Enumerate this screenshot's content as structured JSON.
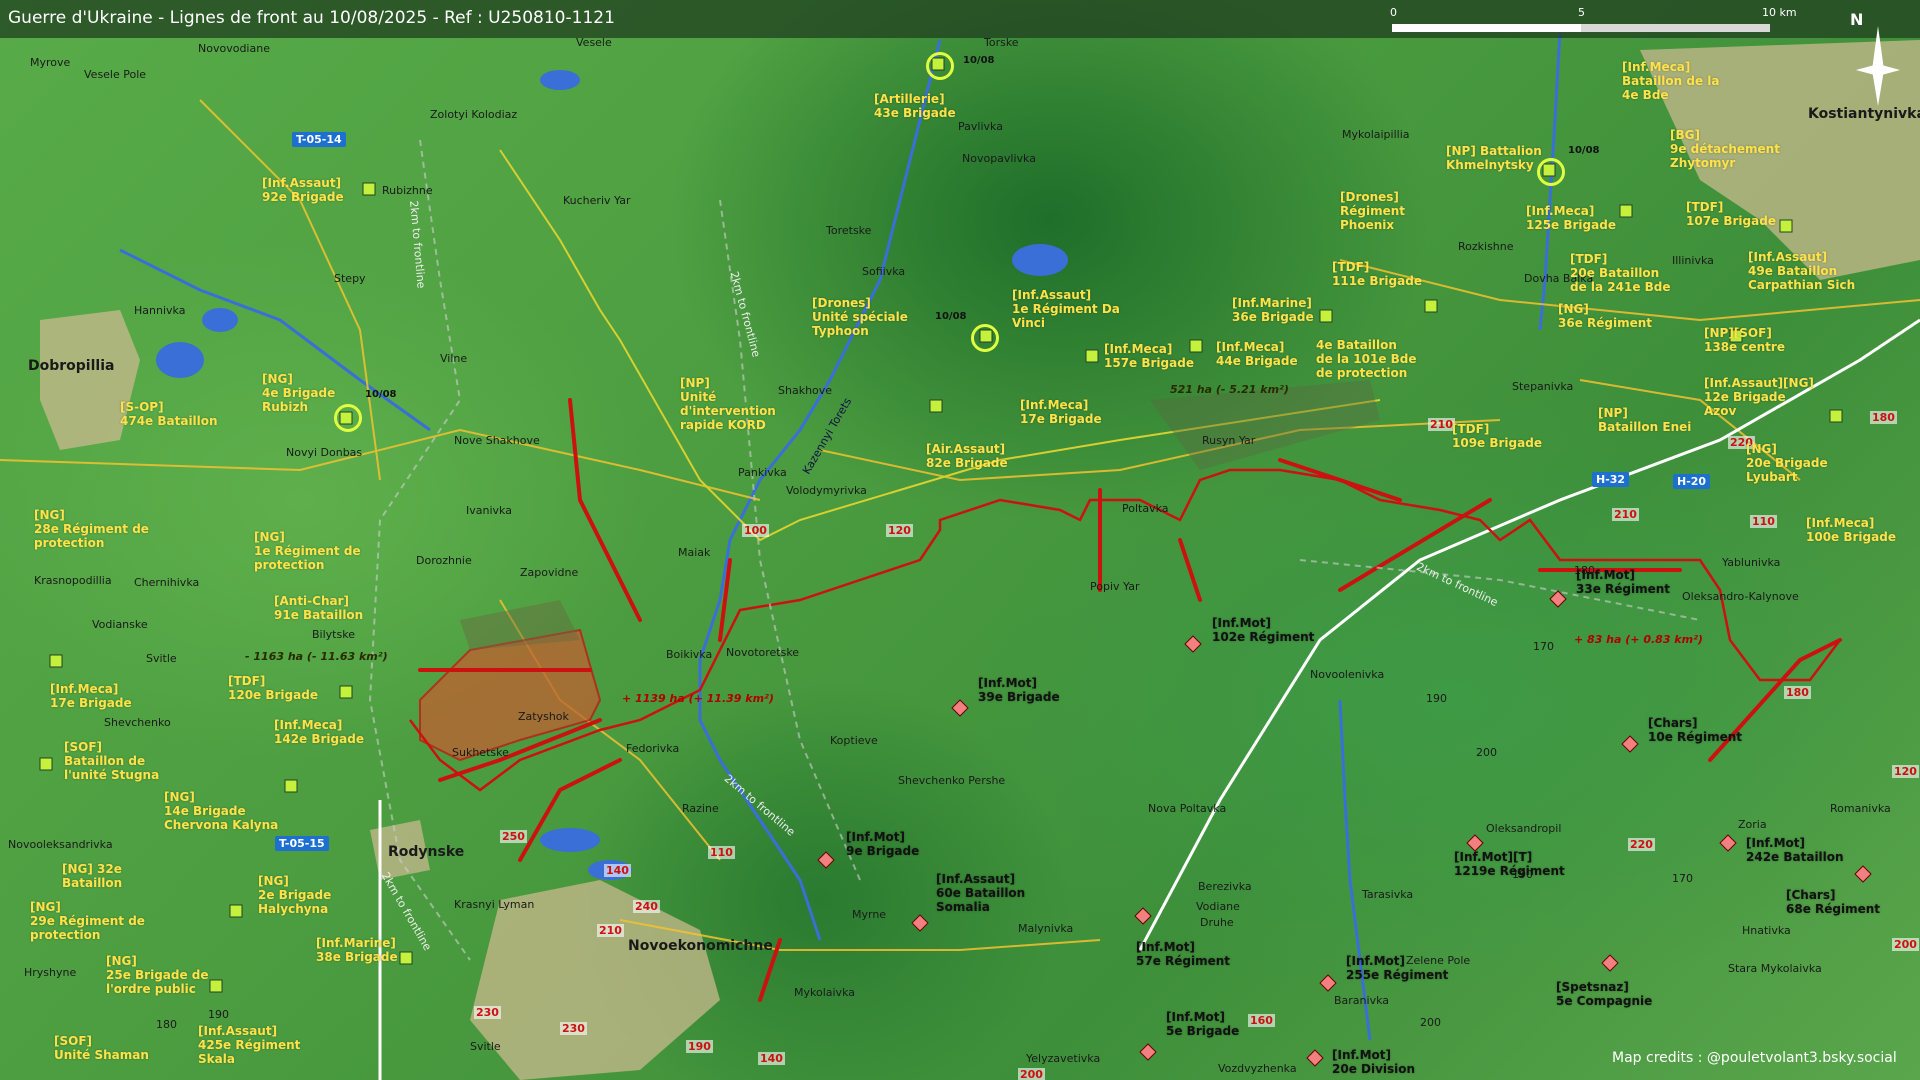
{
  "header": {
    "title": "Guerre d'Ukraine - Lignes de front au 10/08/2025 - Ref : U250810-1121"
  },
  "scale": {
    "labels": [
      "0",
      "5",
      "10 km"
    ]
  },
  "north": "N",
  "credits": "Map credits : @pouletvolant3.bsky.social",
  "dates": [
    "10/08",
    "10/08",
    "10/08",
    "10/08"
  ],
  "areas": {
    "loss1": "- 1163 ha (- 11.63 km²)",
    "gain1": "+ 1139 ha (+ 11.39 km²)",
    "loss2": "521 ha (- 5.21 km²)",
    "gain2": "+ 83 ha (+ 0.83 km²)"
  },
  "roads": [
    "T-05-14",
    "T-05-15",
    "H-32",
    "H-20"
  ],
  "routes": [
    "100",
    "120",
    "210",
    "220",
    "210",
    "110",
    "180",
    "250",
    "110",
    "140",
    "240",
    "210",
    "230",
    "230",
    "190",
    "140",
    "200",
    "160",
    "220",
    "120",
    "200",
    "180"
  ],
  "labels": {
    "frontline": [
      "2km to frontline",
      "2km to frontline",
      "2km to frontline",
      "2km to frontline",
      "2km to frontline"
    ],
    "canal": "Kazennyi Torets"
  },
  "towns": [
    "Vesele",
    "Torske",
    "Myrove",
    "Vesele Pole",
    "Novovodiane",
    "Zolotyi Kolodiaz",
    "Pavlivka",
    "Novopavlivka",
    "Rubizhne",
    "Kucheriv Yar",
    "Toretske",
    "Mykolaipillia",
    "Kostiantynivka",
    "Stepy",
    "Sofiivka",
    "Rozkishne",
    "Illinivka",
    "Dovha Balka",
    "Hannivka",
    "Dobropillia",
    "Vilne",
    "Shakhove",
    "Stepanivka",
    "Novyi Donbas",
    "Nove Shakhove",
    "Rusyn Yar",
    "Pankivka",
    "Ivanivka",
    "Volodymyrivka",
    "Poltavka",
    "Dorozhnie",
    "Maiak",
    "Krasnopodillia",
    "Chernihivka",
    "Zapovidne",
    "Yablunivka",
    "Popiv Yar",
    "Oleksandro-Kalynove",
    "Bilytske",
    "Vodianske",
    "Svitle",
    "Boikivka",
    "Novotoretske",
    "Novoolenivka",
    "Shevchenko",
    "Zatyshok",
    "Koptieve",
    "Sukhetske",
    "Fedorivka",
    "Shevchenko Pershe",
    "Nova Poltavka",
    "Oleksandropil",
    "Romanivka",
    "Novooleksandrivka",
    "Razine",
    "Zoria",
    "Rodynske",
    "Berezivka",
    "Tarasivka",
    "Vodiane",
    "Druhe",
    "Krasnyi Lyman",
    "Myrne",
    "Malynivka",
    "Hnativka",
    "Novoekonomichne",
    "Zelene Pole",
    "Stara Mykolaivka",
    "Hryshyne",
    "Mykolaivka",
    "Baranivka",
    "Svitle",
    "Yelyzavetivka",
    "Vozdvyzhenka"
  ],
  "spot_heights": [
    "170",
    "190",
    "200",
    "180",
    "190",
    "180",
    "170",
    "190",
    "200"
  ],
  "units_ua": [
    "[Artillerie]\n43e Brigade",
    "[Inf.Assaut]\n92e Brigade",
    "[NG]\n4e Brigade\nRubizh",
    "[S-OP]\n474e Bataillon",
    "[Drones]\nUnité spéciale\nTyphoon",
    "[Inf.Assaut]\n1e Régiment Da\nVinci",
    "[NP]\nUnité\nd'intervention\nrapide KORD",
    "[Inf.Meca]\n157e Brigade",
    "[Inf.Meca]\n44e Brigade",
    "[Inf.Marine]\n36e Brigade",
    "[Inf.Meca]\n17e Brigade",
    "[Air.Assaut]\n82e Brigade",
    "[Drones]\nRégiment\nPhoenix",
    "[TDF]\n111e Brigade",
    "4e Bataillon\nde la 101e Bde\nde protection",
    "[NP] Battalion\nKhmelnytsky",
    "[Inf.Meca]\n125e Brigade",
    "[Inf.Meca]\nBataillon de la\n4e Bde",
    "[BG]\n9e détachement\nZhytomyr",
    "[TDF]\n107e Brigade",
    "[TDF]\n20e Bataillon\nde la 241e Bde",
    "[Inf.Assaut]\n49e Bataillon\nCarpathian Sich",
    "[NG]\n36e Régiment",
    "[NP][SOF]\n138e centre",
    "[Inf.Assaut][NG]\n12e Brigade\nAzov",
    "[NP]\nBataillon Enei",
    "[TDF]\n109e Brigade",
    "[NG]\n20e Brigade\nLyubart",
    "[Inf.Meca]\n100e Brigade",
    "[NG]\n28e Régiment de\nprotection",
    "[NG]\n1e Régiment de\nprotection",
    "[Anti-Char]\n91e Bataillon",
    "[Inf.Meca]\n17e Brigade",
    "[TDF]\n120e Brigade",
    "[Inf.Meca]\n142e Brigade",
    "[SOF]\nBataillon de\nl'unité Stugna",
    "[NG]\n14e Brigade\nChervona Kalyna",
    "[NG] 32e\nBataillon",
    "[NG]\n2e Brigade\nHalychyna",
    "[NG]\n29e Régiment de\nprotection",
    "[Inf.Marine]\n38e Brigade",
    "[NG]\n25e Brigade de\nl'ordre public",
    "[SOF]\nUnité Shaman",
    "[Inf.Assaut]\n425e Régiment\nSkala"
  ],
  "units_ru": [
    "[Inf.Mot]\n102e Régiment",
    "[Inf.Mot]\n33e Régiment",
    "[Inf.Mot]\n39e Brigade",
    "[Chars]\n10e Régiment",
    "[Inf.Mot]\n9e Brigade",
    "[Inf.Assaut]\n60e Bataillon\nSomalia",
    "[Inf.Mot][T]\n1219e Régiment",
    "[Inf.Mot]\n242e Bataillon",
    "[Chars]\n68e Régiment",
    "[Inf.Mot]\n57e Régiment",
    "[Inf.Mot]\n255e Régiment",
    "[Spetsnaz]\n5e Compagnie",
    "[Inf.Mot]\n5e Brigade",
    "[Inf.Mot]\n20e Division"
  ],
  "colors": {
    "ua_unit": "#ffe24a",
    "ru_front": "#cc1111",
    "ru_gain_fill": "#c06030",
    "water": "#3a6fd8",
    "road_badge": "#1d6fd0"
  }
}
